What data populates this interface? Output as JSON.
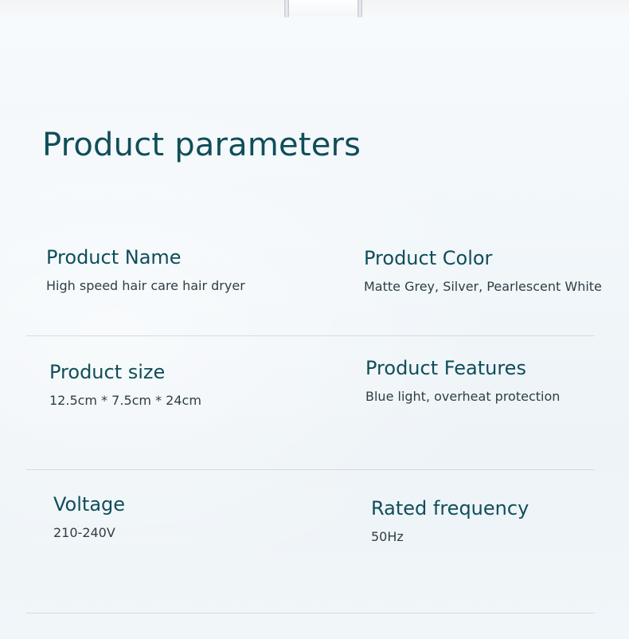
{
  "title": "Product parameters",
  "params": [
    {
      "label": "Product Name",
      "value": "High speed hair care hair dryer"
    },
    {
      "label": "Product Color",
      "value": "Matte Grey, Silver, Pearlescent White"
    },
    {
      "label": "Product size",
      "value": "12.5cm * 7.5cm * 24cm"
    },
    {
      "label": "Product Features",
      "value": "Blue light, overheat protection"
    },
    {
      "label": "Voltage",
      "value": "210-240V"
    },
    {
      "label": "Rated frequency",
      "value": "50Hz"
    }
  ],
  "colors": {
    "heading": "#0f4e5a",
    "value_text": "#2e3f45",
    "divider": "#d3dce1",
    "background": "#f1f6f9"
  }
}
